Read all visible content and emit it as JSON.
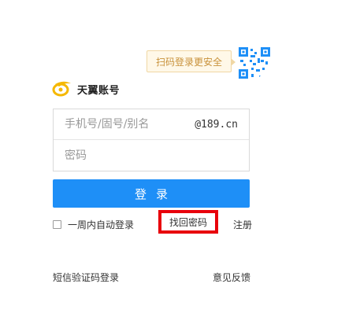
{
  "qr_tip": {
    "text": "扫码登录更安全"
  },
  "logo": {
    "text": "天翼账号"
  },
  "form": {
    "account_placeholder": "手机号/固号/别名",
    "account_suffix": "@189.cn",
    "password_placeholder": "密码"
  },
  "login_button": {
    "label": "登录"
  },
  "options": {
    "remember_label": "一周内自动登录",
    "remember_checked": false,
    "forgot_label": "找回密码",
    "register_label": "注册"
  },
  "footer": {
    "sms_login_label": "短信验证码登录",
    "feedback_label": "意见反馈"
  },
  "colors": {
    "primary_button": "#1e8ff7",
    "highlight_frame": "#e8000b",
    "tip_text": "#c8913a",
    "logo_yellow": "#f5b800"
  }
}
